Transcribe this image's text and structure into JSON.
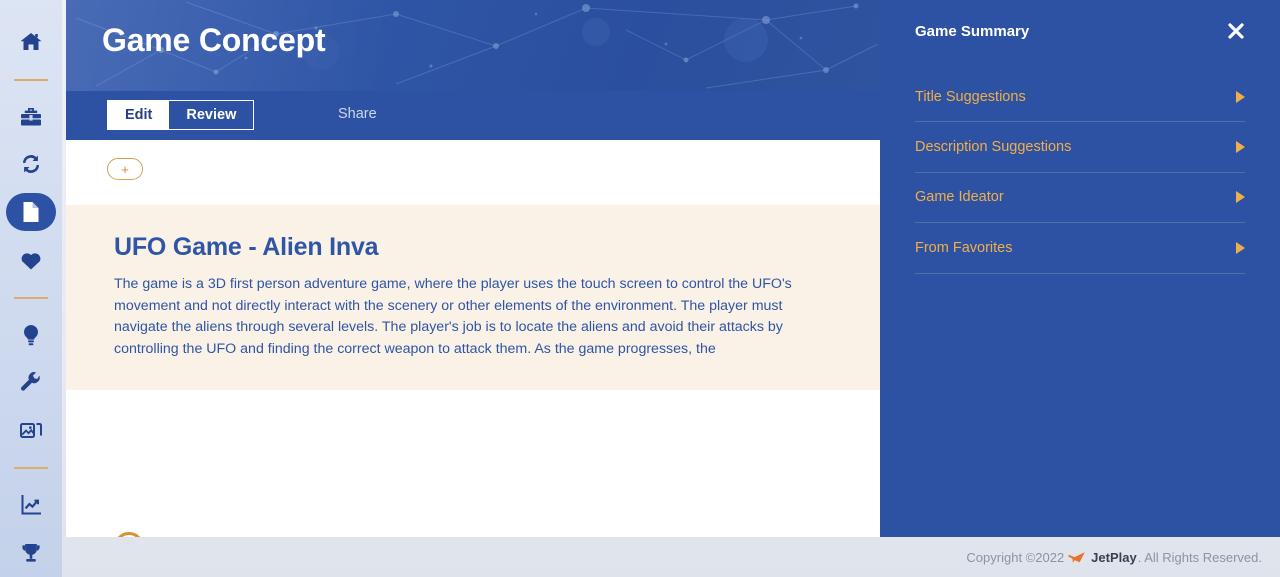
{
  "sidebar": {
    "items": [
      {
        "name": "home",
        "icon": "home-icon",
        "active": false
      },
      {
        "name": "toolbox",
        "icon": "toolbox-icon",
        "active": false
      },
      {
        "name": "sync",
        "icon": "refresh-icon",
        "active": false
      },
      {
        "name": "documents",
        "icon": "document-icon",
        "active": true
      },
      {
        "name": "favorites",
        "icon": "heart-icon",
        "active": false
      },
      {
        "name": "ideas",
        "icon": "lightbulb-icon",
        "active": false
      },
      {
        "name": "tools",
        "icon": "wrench-icon",
        "active": false
      },
      {
        "name": "media",
        "icon": "images-icon",
        "active": false
      },
      {
        "name": "analytics",
        "icon": "chart-line-icon",
        "active": false
      },
      {
        "name": "awards",
        "icon": "trophy-icon",
        "active": false
      }
    ]
  },
  "header": {
    "title": "Game Concept"
  },
  "tabs": {
    "edit_label": "Edit",
    "review_label": "Review",
    "share_label": "Share",
    "active": "Edit"
  },
  "content": {
    "add_top_label": "+",
    "add_bottom_label": "+",
    "card": {
      "title": "UFO Game - Alien Inva",
      "body": "The game is a 3D first person adventure game, where the player uses the touch screen to control the UFO's movement and not directly interact with the scenery or other elements of the environment. The player must navigate the aliens through several levels. The player's job is to locate the aliens and avoid their attacks by controlling the UFO and finding the correct weapon to attack them. As the game progresses, the"
    }
  },
  "panel": {
    "title": "Game Summary",
    "close_icon": "close-icon",
    "items": [
      {
        "label": "Title Suggestions"
      },
      {
        "label": "Description Suggestions"
      },
      {
        "label": "Game Ideator"
      },
      {
        "label": "From Favorites"
      }
    ]
  },
  "footer": {
    "copyright": "Copyright ©2022",
    "brand": "JetPlay",
    "rights": ". All Rights Reserved.",
    "icon": "jet-icon"
  },
  "colors": {
    "brand_blue": "#2e52a3",
    "accent_orange": "#d9912f",
    "panel_label_orange": "#f0ae4a",
    "card_cream": "#faf2e6",
    "sidebar_top": "#dde5f4",
    "sidebar_bottom": "#c3d1ea"
  }
}
